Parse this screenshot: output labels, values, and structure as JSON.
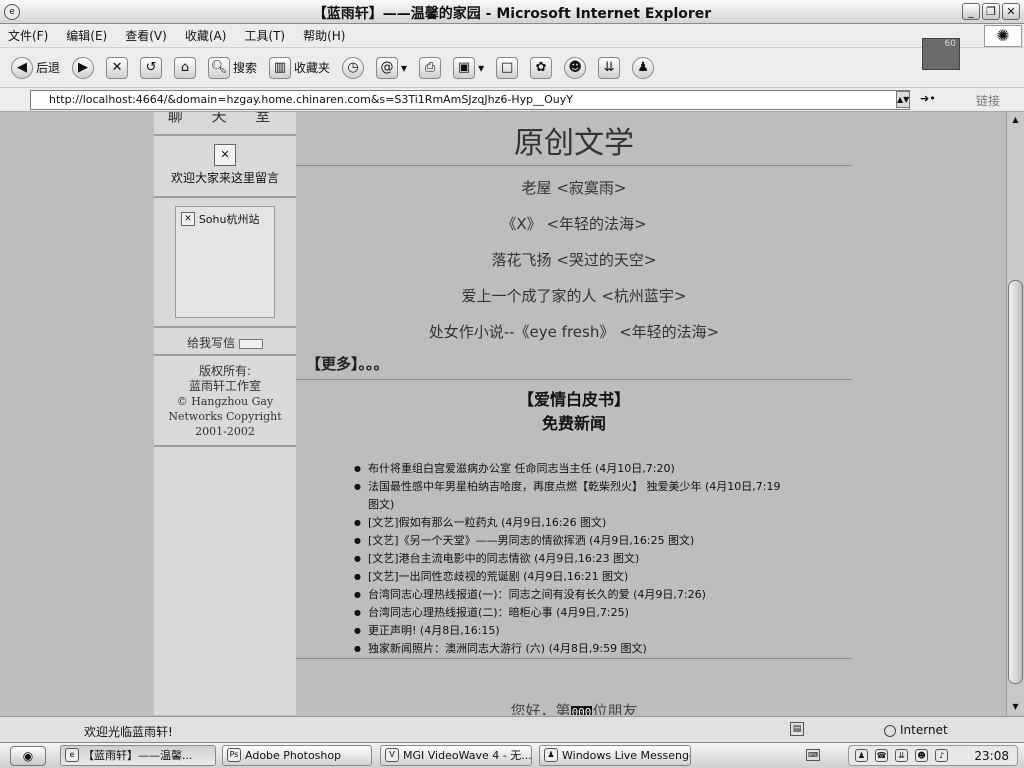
{
  "window": {
    "title": "【蓝雨轩】——温馨的家园 - Microsoft Internet Explorer"
  },
  "menu": [
    "文件(F)",
    "编辑(E)",
    "查看(V)",
    "收藏(A)",
    "工具(T)",
    "帮助(H)"
  ],
  "toolbar": {
    "back_label": "后退",
    "search_label": "搜索",
    "favorites_label": "收藏夹",
    "dark_widget_value": "60"
  },
  "address": {
    "url": "http://localhost:4664/&domain=hzgay.home.chinaren.com&s=S3Ti1RmAmSJzqJhz6-Hyp__OuyY",
    "links_label": "链接"
  },
  "sidebar": {
    "chatroom": "聊 天 室",
    "guestbook_text": "欢迎大家来这里留言",
    "sohu_label": "Sohu杭州站",
    "writeme": "给我写信",
    "copyright_lines": [
      "版权所有:",
      "蓝雨轩工作室",
      "© Hangzhou Gay",
      "Networks Copyright",
      "2001-2002"
    ]
  },
  "main": {
    "title": "原创文学",
    "articles": [
      "老屋 <寂寞雨>",
      "《X》 <年轻的法海>",
      "落花飞扬 <哭过的天空>",
      "爱上一个成了家的人 <杭州蓝宇>",
      "处女作小说--《eye fresh》 <年轻的法海>"
    ],
    "more": "【更多】。。。",
    "news_heading_1": "【爱情白皮书】",
    "news_heading_2": "免费新闻",
    "news": [
      "布什将重组白宫爱滋病办公室 任命同志当主任 (4月10日,7:20)",
      "法国最性感中年男星柏纳吉哈度，再度点燃【乾柴烈火】 独爱美少年 (4月10日,7:19 图文)",
      "[文艺]假如有那么一粒药丸 (4月9日,16:26 图文)",
      "[文艺]《另一个天堂》——男同志的情欲挥洒 (4月9日,16:25 图文)",
      "[文艺]港台主流电影中的同志情欲 (4月9日,16:23 图文)",
      "[文艺]一出同性恋歧视的荒诞剧 (4月9日,16:21 图文)",
      "台湾同志心理热线报道(一)：同志之间有没有长久的爱 (4月9日,7:26)",
      "台湾同志心理热线报道(二)：暗柜心事 (4月9日,7:25)",
      "更正声明! (4月8日,16:15)",
      "独家新闻照片：澳洲同志大游行 (六) (4月8日,9:59 图文)"
    ],
    "visitor_prefix": "您好，第",
    "visitor_count": "000",
    "visitor_suffix": "位朋友"
  },
  "status": {
    "text": "欢迎光临蓝雨轩!",
    "zone": "Internet"
  },
  "taskbar": {
    "tasks": [
      "【蓝雨轩】——温馨...",
      "Adobe Photoshop",
      "MGI VideoWave 4 - 无...",
      "Windows Live Messenger"
    ],
    "clock": "23:08"
  }
}
